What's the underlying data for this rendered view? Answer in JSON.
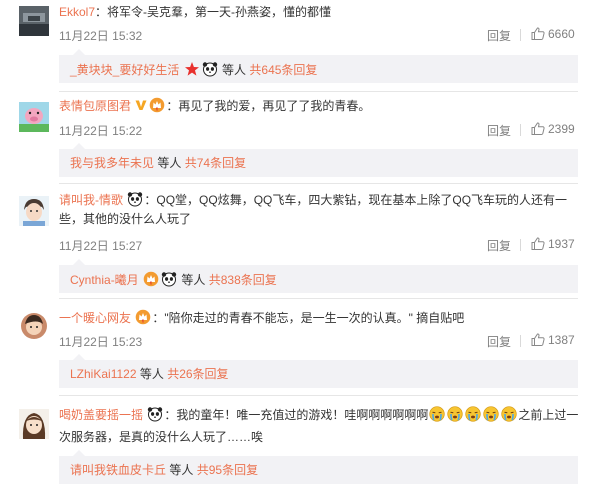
{
  "reply_label": "回复",
  "comments": [
    {
      "user": "Ekkol7",
      "sep": "：",
      "text": "将军令-吴克羣，第一天-孙燕姿，懂的都懂",
      "time": "11月22日 15:32",
      "likes": "6660",
      "sub_user": "_黄块块_要好好生活",
      "sub_pre": "等人",
      "sub_count": "共645条回复"
    },
    {
      "user": "表情包原图君",
      "sep": "：",
      "text": "再见了我的爱，再见了了我的青春。",
      "time": "11月22日 15:22",
      "likes": "2399",
      "sub_user": "我与我多年未见",
      "sub_pre": "等人",
      "sub_count": "共74条回复"
    },
    {
      "user": "请叫我-情歌",
      "sep": "：",
      "text": "QQ堂，QQ炫舞，QQ飞车，四大紫钻，现在基本上除了QQ飞车玩的人还有一",
      "text2": "些，其他的没什么人玩了",
      "time": "11月22日 15:27",
      "likes": "1937",
      "sub_user": "Cynthia-曦月",
      "sub_pre": "等人",
      "sub_count": "共838条回复"
    },
    {
      "user": "一个暖心网友",
      "sep": "：",
      "text": "\"陪你走过的青春不能忘，是一生一次的认真。\" 摘自贴吧",
      "time": "11月22日 15:23",
      "likes": "1387",
      "sub_user": "LZhiKai1122",
      "sub_pre": "等人",
      "sub_count": "共26条回复"
    },
    {
      "user": "喝奶盖要摇一摇",
      "sep": "：",
      "text": "我的童年！唯一充值过的游戏！哇啊啊啊啊啊啊",
      "text_after": "之前上过一",
      "text2": "次服务器，是真的没什么人玩了……唉",
      "sub_user": "请叫我铁血皮卡丘",
      "sub_pre": "等人",
      "sub_count": "共95条回复"
    }
  ],
  "icons": {
    "like": "thumbs-up-icon",
    "panda": "panda-emoji-icon",
    "crying": "crying-emoji-icon",
    "vip": "vip-badge-icon",
    "star": "red-star-icon"
  },
  "colors": {
    "link": "#eb7350",
    "text": "#333333",
    "meta": "#808080",
    "subbox": "#f2f2f5"
  }
}
